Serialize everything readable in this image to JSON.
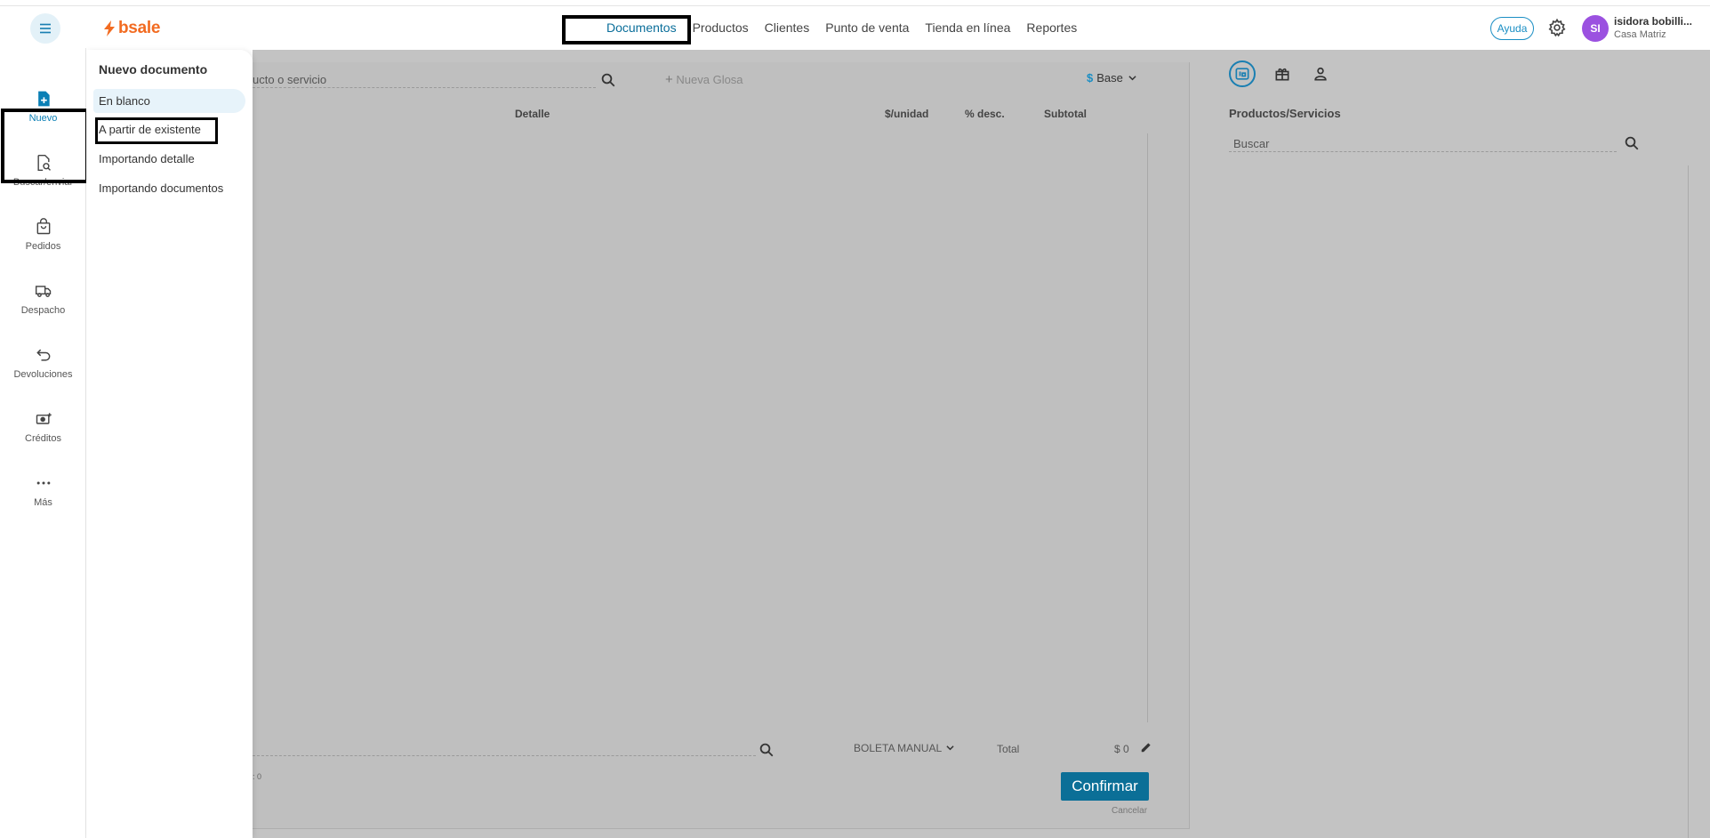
{
  "topbar": {
    "logo_text": "bsale",
    "nav": [
      "Documentos",
      "Productos",
      "Clientes",
      "Punto de venta",
      "Tienda en línea",
      "Reportes"
    ],
    "help_label": "Ayuda",
    "avatar_initials": "SI",
    "user_name": "isidora bobilli...",
    "user_branch": "Casa Matriz"
  },
  "sidebar": {
    "items": [
      {
        "label": "Nuevo",
        "icon": "new-document-icon"
      },
      {
        "label": "Buscar/enviar",
        "icon": "search-document-icon"
      },
      {
        "label": "Pedidos",
        "icon": "shopping-bag-icon"
      },
      {
        "label": "Despacho",
        "icon": "truck-icon"
      },
      {
        "label": "Devoluciones",
        "icon": "return-arrow-icon"
      },
      {
        "label": "Créditos",
        "icon": "credit-cash-icon"
      },
      {
        "label": "Más",
        "icon": "more-dots-icon"
      }
    ]
  },
  "dropdown": {
    "title": "Nuevo documento",
    "items": [
      "En blanco",
      "A partir de existente",
      "Importando detalle",
      "Importando documentos"
    ]
  },
  "document": {
    "search_placeholder": "ucto o servicio",
    "nueva_glosa": "Nueva Glosa",
    "price_list_symbol": "$",
    "price_list": "Base",
    "columns": [
      "Detalle",
      "$/unidad",
      "% desc.",
      "Subtotal"
    ],
    "document_type": "BOLETA MANUAL",
    "total_label": "Total",
    "total_value": "$ 0",
    "item_count": ": 0",
    "confirm_label": "Confirmar",
    "cancel_label": "Cancelar"
  },
  "right_panel": {
    "title": "Productos/Servicios",
    "search_placeholder": "Buscar"
  },
  "colors": {
    "accent": "#0a7fb5",
    "brand": "#f26b21",
    "confirm": "#0b6f97",
    "avatar": "#9b51e0"
  }
}
